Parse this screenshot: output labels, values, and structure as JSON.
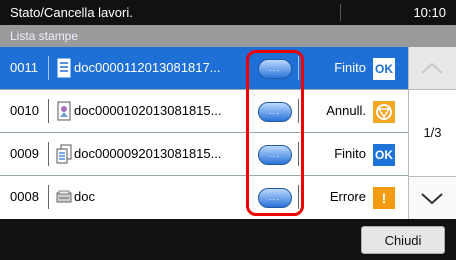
{
  "header": {
    "title": "Stato/Cancella lavori.",
    "time": "10:10"
  },
  "list_title": "Lista stampe",
  "rows": [
    {
      "number": "0011",
      "file": "doc0000112013081817...",
      "status": "Finito",
      "status_icon": "ok",
      "selected": true
    },
    {
      "number": "0010",
      "file": "doc0000102013081815...",
      "status": "Annull.",
      "status_icon": "cancelled",
      "selected": false
    },
    {
      "number": "0009",
      "file": "doc0000092013081815...",
      "status": "Finito",
      "status_icon": "ok",
      "selected": false
    },
    {
      "number": "0008",
      "file": "doc",
      "status": "Errore",
      "status_icon": "error",
      "selected": false
    }
  ],
  "details_button_label": "...",
  "ok_label": "OK",
  "error_mark": "!",
  "pagination": {
    "page": "1/3"
  },
  "footer": {
    "close_label": "Chiudi"
  },
  "colors": {
    "selected_row": "#1e6fd6",
    "highlight": "#e00000",
    "title_bar": "#111111",
    "list_header": "#9a9a9a"
  }
}
